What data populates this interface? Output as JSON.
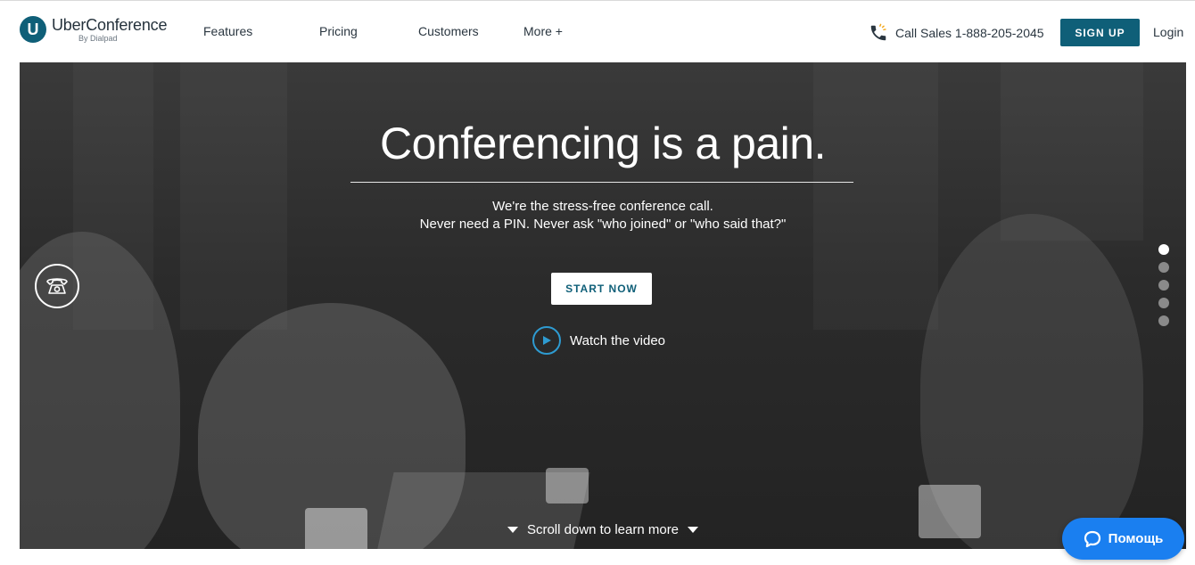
{
  "brand": {
    "logo_letter": "U",
    "name": "UberConference",
    "subtitle": "By Dialpad",
    "color": "#0f5f78"
  },
  "nav": {
    "items": [
      {
        "label": "Features"
      },
      {
        "label": "Pricing"
      },
      {
        "label": "Customers"
      },
      {
        "label": "More +"
      }
    ]
  },
  "header_right": {
    "call_sales": "Call Sales 1-888-205-2045",
    "call_icon": "phone-ringing-icon",
    "signup_label": "SIGN UP",
    "login_label": "Login"
  },
  "hero": {
    "title": "Conferencing is a pain.",
    "subtitle_line1": "We're the stress-free conference call.",
    "subtitle_line2": "Never need a PIN. Never ask \"who joined\" or \"who said that?\"",
    "start_label": "START NOW",
    "watch_label": "Watch the video",
    "scroll_label": "Scroll down to learn more",
    "slides_total": 5,
    "slide_active": 1,
    "accent_color": "#2e9bd1"
  },
  "help": {
    "label": "Помощь",
    "color": "#1a7ff0"
  }
}
